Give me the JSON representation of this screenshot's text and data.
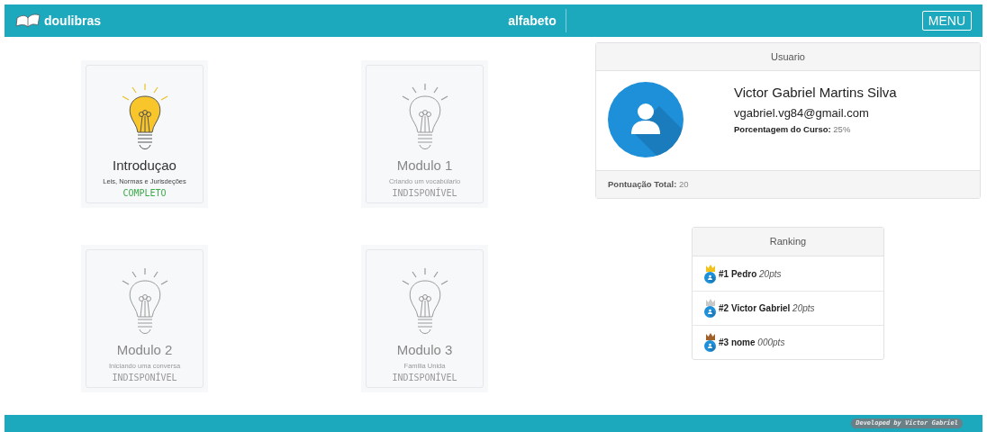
{
  "navbar": {
    "brand": "doulibras",
    "title": "alfabeto",
    "menu_button": "MENU"
  },
  "modules": [
    {
      "title": "Introduçao",
      "subtitle": "Leis, Normas e Jurisdeções",
      "status": "COMPLETO",
      "completed": true
    },
    {
      "title": "Modulo 1",
      "subtitle": "Criando um vocabúlario",
      "status": "INDISPONÍVEL",
      "completed": false
    },
    {
      "title": "Modulo 2",
      "subtitle": "Iniciando uma conversa",
      "status": "INDISPONÍVEL",
      "completed": false
    },
    {
      "title": "Modulo 3",
      "subtitle": "Familia Unida",
      "status": "INDISPONÍVEL",
      "completed": false
    }
  ],
  "user_card": {
    "header": "Usuario",
    "name": "Victor Gabriel Martins Silva",
    "email": "vgabriel.vg84@gmail.com",
    "progress_label": "Porcentagem do Curso:",
    "progress_value": "25%",
    "score_label": "Pontuação Total:",
    "score_value": "20"
  },
  "ranking": {
    "header": "Ranking",
    "items": [
      {
        "name": "#1 Pedro",
        "points": "20pts",
        "color": "#f2c21b"
      },
      {
        "name": "#2 Victor Gabriel",
        "points": "20pts",
        "color": "#c8c8c8"
      },
      {
        "name": "#3 nome",
        "points": "000pts",
        "color": "#a0612a"
      }
    ]
  },
  "footer": {
    "credit": "Developed by Victor Gabriel"
  }
}
